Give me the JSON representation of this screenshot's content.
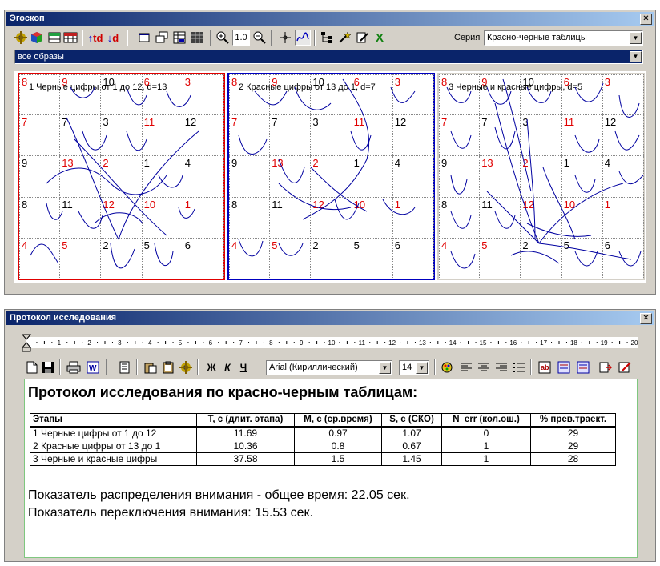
{
  "ego": {
    "title": "Эгоскоп",
    "series_label": "Серия",
    "series_value": "Красно-черные таблицы",
    "filter_value": "все образы",
    "zoom_value": "1.0",
    "tool_td_up": "td",
    "tool_td_down": "d",
    "tool_x": "X",
    "tables": [
      {
        "caption": "1 Черные цифры от 1 до 12, d=13",
        "frame_color": "#e00000",
        "cells": [
          {
            "n": "8",
            "c": "r"
          },
          {
            "n": "9",
            "c": "r"
          },
          {
            "n": "10",
            "c": "b"
          },
          {
            "n": "6",
            "c": "r"
          },
          {
            "n": "3",
            "c": "r"
          },
          {
            "n": "7",
            "c": "r"
          },
          {
            "n": "7",
            "c": "b"
          },
          {
            "n": "3",
            "c": "b"
          },
          {
            "n": "11",
            "c": "r"
          },
          {
            "n": "12",
            "c": "b"
          },
          {
            "n": "9",
            "c": "b"
          },
          {
            "n": "13",
            "c": "r"
          },
          {
            "n": "2",
            "c": "r"
          },
          {
            "n": "1",
            "c": "b"
          },
          {
            "n": "4",
            "c": "b"
          },
          {
            "n": "8",
            "c": "b"
          },
          {
            "n": "11",
            "c": "b"
          },
          {
            "n": "12",
            "c": "r"
          },
          {
            "n": "10",
            "c": "r"
          },
          {
            "n": "1",
            "c": "r"
          },
          {
            "n": "4",
            "c": "r"
          },
          {
            "n": "5",
            "c": "r"
          },
          {
            "n": "2",
            "c": "b"
          },
          {
            "n": "5",
            "c": "b"
          },
          {
            "n": "6",
            "c": "b"
          }
        ]
      },
      {
        "caption": "2 Красные цифры от 13 до 1, d=7",
        "frame_color": "#0000c0",
        "cells": [
          {
            "n": "8",
            "c": "r"
          },
          {
            "n": "9",
            "c": "r"
          },
          {
            "n": "10",
            "c": "b"
          },
          {
            "n": "6",
            "c": "r"
          },
          {
            "n": "3",
            "c": "r"
          },
          {
            "n": "7",
            "c": "r"
          },
          {
            "n": "7",
            "c": "b"
          },
          {
            "n": "3",
            "c": "b"
          },
          {
            "n": "11",
            "c": "r"
          },
          {
            "n": "12",
            "c": "b"
          },
          {
            "n": "9",
            "c": "b"
          },
          {
            "n": "13",
            "c": "r"
          },
          {
            "n": "2",
            "c": "r"
          },
          {
            "n": "1",
            "c": "b"
          },
          {
            "n": "4",
            "c": "b"
          },
          {
            "n": "8",
            "c": "b"
          },
          {
            "n": "11",
            "c": "b"
          },
          {
            "n": "12",
            "c": "r"
          },
          {
            "n": "10",
            "c": "r"
          },
          {
            "n": "1",
            "c": "r"
          },
          {
            "n": "4",
            "c": "r"
          },
          {
            "n": "5",
            "c": "r"
          },
          {
            "n": "2",
            "c": "b"
          },
          {
            "n": "5",
            "c": "b"
          },
          {
            "n": "6",
            "c": "b"
          }
        ]
      },
      {
        "caption": "3 Черные и красные цифры, d=5",
        "frame_color": "#d4d0c8",
        "cells": [
          {
            "n": "8",
            "c": "r"
          },
          {
            "n": "9",
            "c": "r"
          },
          {
            "n": "10",
            "c": "b"
          },
          {
            "n": "6",
            "c": "r"
          },
          {
            "n": "3",
            "c": "r"
          },
          {
            "n": "7",
            "c": "r"
          },
          {
            "n": "7",
            "c": "b"
          },
          {
            "n": "3",
            "c": "b"
          },
          {
            "n": "11",
            "c": "r"
          },
          {
            "n": "12",
            "c": "b"
          },
          {
            "n": "9",
            "c": "b"
          },
          {
            "n": "13",
            "c": "r"
          },
          {
            "n": "2",
            "c": "r"
          },
          {
            "n": "1",
            "c": "b"
          },
          {
            "n": "4",
            "c": "b"
          },
          {
            "n": "8",
            "c": "b"
          },
          {
            "n": "11",
            "c": "b"
          },
          {
            "n": "12",
            "c": "r"
          },
          {
            "n": "10",
            "c": "r"
          },
          {
            "n": "1",
            "c": "r"
          },
          {
            "n": "4",
            "c": "r"
          },
          {
            "n": "5",
            "c": "r"
          },
          {
            "n": "2",
            "c": "b"
          },
          {
            "n": "5",
            "c": "b"
          },
          {
            "n": "6",
            "c": "b"
          }
        ]
      }
    ]
  },
  "protocol": {
    "title": "Протокол исследования",
    "ruler_labels": [
      "1",
      "2",
      "3",
      "4",
      "5",
      "6",
      "7",
      "8",
      "9",
      "10",
      "11",
      "12",
      "13",
      "14",
      "15",
      "16",
      "17",
      "18",
      "19",
      "20"
    ],
    "font_value": "Arial (Кириллический)",
    "size_value": "14",
    "bold_label": "Ж",
    "italic_label": "К",
    "underline_label": "Ч",
    "heading": "Протокол исследования по красно-черным таблицам:",
    "columns": [
      "Этапы",
      "T, с (длит. этапа)",
      "M, с (ср.время)",
      "S, с (СКО)",
      "N_err (кол.ош.)",
      "% прев.траект."
    ],
    "rows": [
      [
        "1 Черные цифры от 1 до 12",
        "11.69",
        "0.97",
        "1.07",
        "0",
        "29"
      ],
      [
        "2 Красные цифры от 13 до 1",
        "10.36",
        "0.8",
        "0.67",
        "1",
        "29"
      ],
      [
        "3 Черные и красные цифры",
        "37.58",
        "1.5",
        "1.45",
        "1",
        "28"
      ]
    ],
    "line1": "Показатель распределения внимания - общее время: 22.05 сек.",
    "line2": "Показатель переключения внимания: 15.53 сек."
  }
}
